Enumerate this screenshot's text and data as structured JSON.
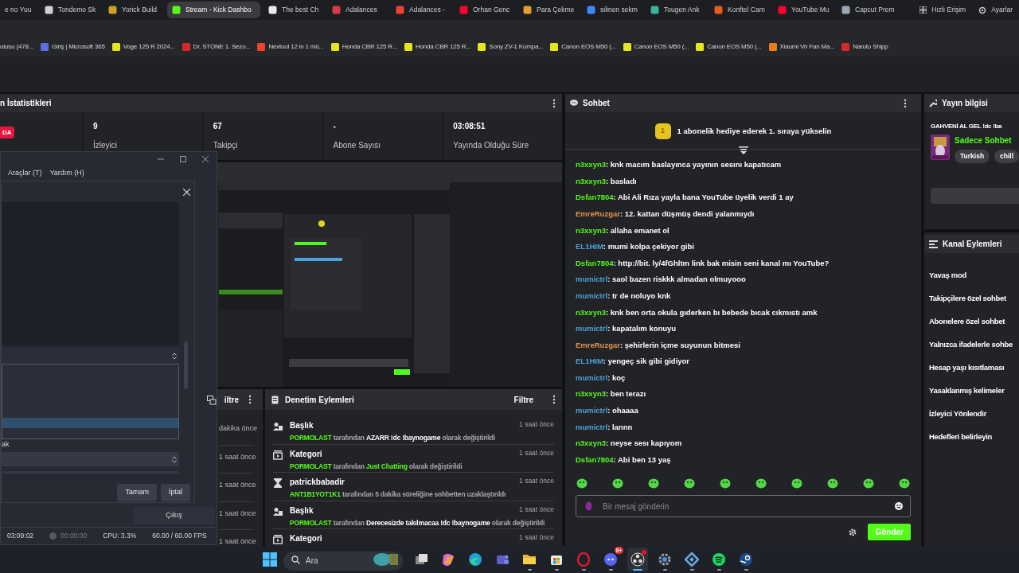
{
  "browser_tabs": [
    {
      "title": "e no Yuu",
      "selected": false
    },
    {
      "title": "Tondemo Sk",
      "color": "#d0d0d0",
      "selected": false
    },
    {
      "title": "Yorick Build",
      "color": "#c9a227",
      "selected": false
    },
    {
      "title": "Stream - Kick Dashbo",
      "color": "#53fc18",
      "selected": true
    },
    {
      "title": "The best Ch",
      "color": "#e8e8e8",
      "selected": false
    },
    {
      "title": "Adalances",
      "color": "#d93a4a",
      "selected": false
    },
    {
      "title": "Adalances -",
      "color": "#ea4335",
      "selected": false
    },
    {
      "title": "Orhan Genc",
      "color": "#ff0033",
      "selected": false
    },
    {
      "title": "Para Çekme",
      "color": "#e0a030",
      "selected": false
    },
    {
      "title": "silinen sekm",
      "color": "#4285f4",
      "selected": false
    },
    {
      "title": "Tougen Ank",
      "color": "#3bb39a",
      "selected": false
    },
    {
      "title": "Konftel Cam",
      "color": "#e85a1e",
      "selected": false
    },
    {
      "title": "YouTube Mu",
      "color": "#ff0033",
      "selected": false
    },
    {
      "title": "Capcut Prem",
      "color": "#9aa7b8",
      "selected": false
    }
  ],
  "browser_menu": [
    "Hızlı Erişim",
    "Ayarlar"
  ],
  "bookmarks": [
    {
      "title": "utusu (478..."
    },
    {
      "title": "Giriş | Microsoft 365",
      "color": "#5b6fe0"
    },
    {
      "title": "Voge 125 R 2024...",
      "color": "#e6e61e"
    },
    {
      "title": "Dr. STONE 1. Sezo...",
      "color": "#d42a2a"
    },
    {
      "title": "Nextool 12 in 1 mü...",
      "color": "#e8462a"
    },
    {
      "title": "Honda CBR 125 R...",
      "color": "#e6e61e"
    },
    {
      "title": "Honda CBR 125 R...",
      "color": "#e6e61e"
    },
    {
      "title": "Sony ZV-1 Kompa...",
      "color": "#e6e61e"
    },
    {
      "title": "Canon EOS M50 (...",
      "color": "#e6e61e"
    },
    {
      "title": "Canon EOS M50 (...",
      "color": "#e6e61e"
    },
    {
      "title": "Canon EOS M50 (...",
      "color": "#e6e61e"
    },
    {
      "title": "Xiaomi Vh Fan Ma...",
      "color": "#f07a1a"
    },
    {
      "title": "Naruto Shipp",
      "color": "#d42a2a"
    }
  ],
  "stats_panel": {
    "title": "n İstatistikleri",
    "live_badge": "DA",
    "stats": [
      {
        "value": "9",
        "label": "İzleyici"
      },
      {
        "value": "67",
        "label": "Takipçi"
      },
      {
        "value": "-",
        "label": "Abone Sayısı"
      },
      {
        "value": "03:08:51",
        "label": "Yayında Olduğu Süre"
      }
    ]
  },
  "obs_window": {
    "menu": [
      "Araçlar (T)",
      "Yardım (H)"
    ],
    "list_rows": [
      {
        "selected": false
      },
      {
        "selected": true
      },
      {
        "selected": false
      }
    ],
    "fragment": "ak",
    "buttons": [
      "Tamam",
      "İptal"
    ],
    "exit_button": "Çıkış",
    "status": [
      "03:09:02",
      "00:00:00",
      "CPU: 3.3%",
      "60.00 / 60.00 FPS"
    ]
  },
  "recent_panel": {
    "title": "iltre",
    "times": [
      "dakika önce",
      "1 saat önce",
      "1 saat önce",
      "1 saat önce",
      "1 saat önce"
    ]
  },
  "moderation": {
    "title": "Denetim Eylemleri",
    "filter": "Filtre",
    "actions": [
      {
        "kind": "title",
        "heading": "Başlık",
        "time": "1 saat önce",
        "actor": "PORMOLAST",
        "connector": "tarafından",
        "value": "AZARR !dc !baynogame",
        "suffix": "olarak değiştirildi"
      },
      {
        "kind": "category",
        "heading": "Kategori",
        "time": "1 saat önce",
        "actor": "PORMOLAST",
        "connector": "tarafından",
        "value": "Just Chatting",
        "suffix": "olarak değiştirildi"
      },
      {
        "kind": "timeout",
        "heading": "patrickbabadir",
        "time": "1 saat önce",
        "actor": "ANT1B1YOT1K1",
        "suffix": "tarafından 5 dakika süreliğine sohbetten uzaklaştırıldı"
      },
      {
        "kind": "title",
        "heading": "Başlık",
        "time": "1 saat önce",
        "actor": "PORMOLAST",
        "connector": "tarafından",
        "value": "Derecesizde takılmacaa !dc !baynogame",
        "suffix": "olarak değiştirildi"
      },
      {
        "kind": "category",
        "heading": "Kategori",
        "time": "1 saat önce"
      }
    ]
  },
  "chat": {
    "title": "Sohbet",
    "medal": "1",
    "banner": "1 abonelik hediye ederek 1. sıraya yükselin",
    "messages": [
      {
        "user": "n3xxyn3",
        "color": "#53fc18",
        "text": ": knk macım baslayınca yayının sesını kapatıcam"
      },
      {
        "user": "n3xxyn3",
        "color": "#53fc18",
        "text": ": basladı"
      },
      {
        "user": "Dsfan7804",
        "color": "#53fc18",
        "text": ": Abi Ali Rıza yayla bana YouTube üyelik verdi 1 ay"
      },
      {
        "user": "EmreRuzgar",
        "color": "#e8914a",
        "text": ": 12. kattan düşmüş dendi yalanmıydı"
      },
      {
        "user": "n3xxyn3",
        "color": "#53fc18",
        "text": ": allaha emanet ol"
      },
      {
        "user": "EL1HIM",
        "color": "#4aa3df",
        "text": ": mumi kolpa çekiyor gibi"
      },
      {
        "user": "Dsfan7804",
        "color": "#53fc18",
        "text": ": http://bit. ly/4fGhltm link bak misin seni kanal mı YouTube?"
      },
      {
        "user": "mumictrl",
        "color": "#4aa3df",
        "text": ": saol bazen riskkk almadan olmuyooo"
      },
      {
        "user": "mumictrl",
        "color": "#4aa3df",
        "text": ": tr de noluyo knk"
      },
      {
        "user": "n3xxyn3",
        "color": "#53fc18",
        "text": ": knk ben orta okula gıderken bı bebede bıcak cıkmıstı amk"
      },
      {
        "user": "mumictrl",
        "color": "#4aa3df",
        "text": ": kapatalım konuyu"
      },
      {
        "user": "EmreRuzgar",
        "color": "#e8914a",
        "text": ": şehirlerin içme suyunun bitmesi"
      },
      {
        "user": "EL1HIM",
        "color": "#4aa3df",
        "text": ": yengeç sik gibi gidiyor"
      },
      {
        "user": "mumictrl",
        "color": "#4aa3df",
        "text": ": koç"
      },
      {
        "user": "n3xxyn3",
        "color": "#53fc18",
        "text": ": ben terazı"
      },
      {
        "user": "mumictrl",
        "color": "#4aa3df",
        "text": ": ohaaaa"
      },
      {
        "user": "mumictrl",
        "color": "#4aa3df",
        "text": ": lannn"
      },
      {
        "user": "n3xxyn3",
        "color": "#53fc18",
        "text": ": neyse sesı kapıyom"
      },
      {
        "user": "Dsfan7804",
        "color": "#53fc18",
        "text": ": Abi ben 13 yaş"
      }
    ],
    "placeholder": "Bir mesaj gönderin",
    "send": "Gönder"
  },
  "stream_info": {
    "title": "Yayın bilgisi",
    "stream_title": "GAHVENİ AL GEL !dc !ba",
    "category": "Sadece Sohbet",
    "tags": [
      "Turkish",
      "chill"
    ]
  },
  "channel_actions": {
    "title": "Kanal Eylemleri",
    "items": [
      "Yavaş mod",
      "Takipçilere özel sohbet",
      "Abonelere özel sohbet",
      "Yalnızca ifadelerle sohbe",
      "Hesap yaşı kısıtlaması",
      "Yasaklanmış kelimeler",
      "İzleyici Yönlendir",
      "Hedefleri belirleyin"
    ]
  },
  "taskbar": {
    "search_placeholder": "Ara",
    "apps": [
      {
        "kind": "taskview",
        "running": false
      },
      {
        "kind": "copilot",
        "running": false
      },
      {
        "kind": "edge",
        "running": false
      },
      {
        "kind": "teams",
        "running": false
      },
      {
        "kind": "folder",
        "running": true
      },
      {
        "kind": "store",
        "running": true
      },
      {
        "kind": "opera",
        "running": true
      },
      {
        "kind": "discord",
        "running": true,
        "badge": "9+"
      },
      {
        "kind": "obs",
        "running": true,
        "active": true
      },
      {
        "kind": "gear",
        "running": true
      },
      {
        "kind": "diamond",
        "running": true
      },
      {
        "kind": "spotify",
        "running": true
      },
      {
        "kind": "steam",
        "running": true
      }
    ]
  }
}
